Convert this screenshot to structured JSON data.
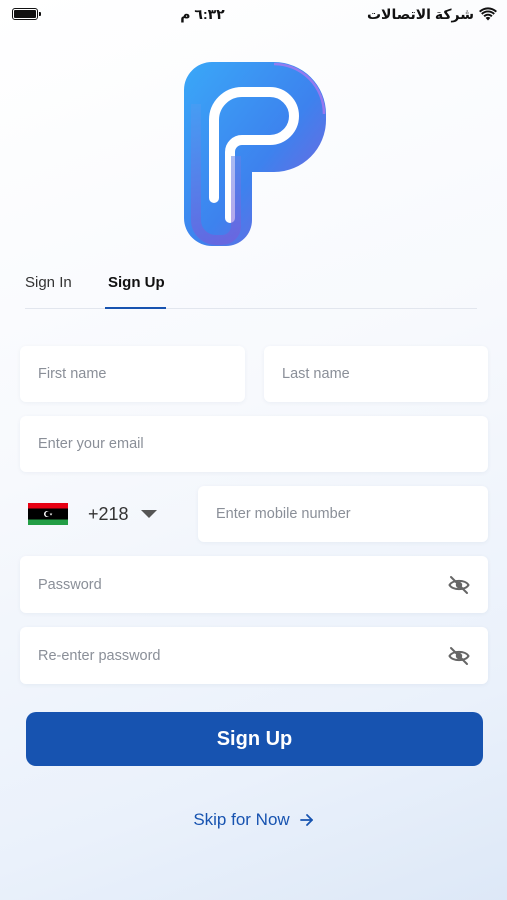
{
  "status_bar": {
    "time": "٦:٣٢ م",
    "carrier": "شركة الاتصالات"
  },
  "tabs": {
    "sign_in": "Sign In",
    "sign_up": "Sign Up",
    "active": "Sign Up"
  },
  "form": {
    "first_name_placeholder": "First name",
    "last_name_placeholder": "Last name",
    "email_placeholder": "Enter your email",
    "dial_code": "+218",
    "mobile_placeholder": "Enter mobile number",
    "password_placeholder": "Password",
    "reenter_password_placeholder": "Re-enter password"
  },
  "actions": {
    "sign_up_button": "Sign Up",
    "skip_label": "Skip for Now"
  },
  "colors": {
    "accent": "#1753b0",
    "logo_gradient": [
      "#3aa0f5",
      "#4a7de8",
      "#7b55d6"
    ]
  }
}
